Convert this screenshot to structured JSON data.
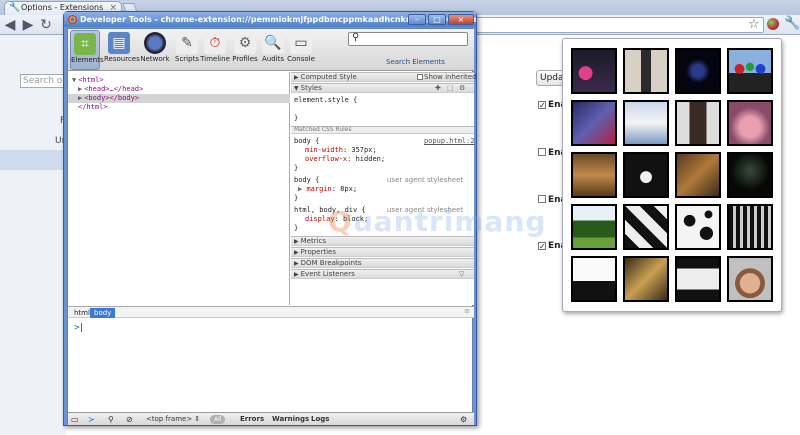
{
  "browser": {
    "tab_title": "Options - Extensions",
    "search_options_placeholder": "Search opti",
    "update_button": "Updat",
    "enable_label": "Ena",
    "nav_labels": [
      "F",
      "Un"
    ]
  },
  "devtools": {
    "window_title": "Developer Tools - chrome-extension://pemmiokmjfppdbmcppmkaadhcnknkkc/popup.html",
    "window_buttons": [
      "minimize",
      "maximize",
      "close"
    ],
    "tools": [
      "Elements",
      "Resources",
      "Network",
      "Scripts",
      "Timeline",
      "Profiles",
      "Audits",
      "Console"
    ],
    "search_label": "Search Elements",
    "dom": [
      "<html>",
      "<head>…</head>",
      "<body></body>",
      "</html>"
    ],
    "sidebar": {
      "computed_style": "Computed Style",
      "show_inherited": "Show inherited",
      "styles": "Styles",
      "element_style": "element.style {",
      "close_brace": "}",
      "matched_rules": "Matched CSS Rules",
      "rule1_selector": "body {",
      "rule1_source": "popup.html:2",
      "rule1_prop1": "min-width",
      "rule1_val1": "357px;",
      "rule1_prop2": "overflow-x",
      "rule1_val2": "hidden;",
      "rule2_selector": "body {",
      "rule2_source": "user agent stylesheet",
      "rule2_prop": "margin",
      "rule2_val": "8px;",
      "rule3_selector": "html, body, div {",
      "rule3_source": "user agent stylesheet",
      "rule3_prop": "display",
      "rule3_val": "block;",
      "metrics": "Metrics",
      "properties": "Properties",
      "dom_breakpoints": "DOM Breakpoints",
      "event_listeners": "Event Listeners"
    },
    "console_tabs": [
      "html",
      "body"
    ],
    "prompt": ">",
    "status": {
      "frame": "<top frame>",
      "all": "All",
      "errors": "Errors",
      "warnings": "Warnings",
      "logs": "Logs"
    }
  },
  "watermark": "uantrimang",
  "colors": {
    "devtools_frame": "#6b92d4",
    "selected_tab": "#3879d9",
    "css_property": "#c80000",
    "tag": "#881280"
  },
  "popup_thumbnails": [
    "pink-monster-photo",
    "person-standing-photo",
    "light-swirl-photo",
    "colored-balls-photo",
    "sneakers-photo",
    "wedding-photo",
    "woman-portrait-photo",
    "hand-photo",
    "railroad-photo",
    "cat-photo",
    "cards-photo",
    "dark-room-photo",
    "tree-photo",
    "puzzle-pattern-photo",
    "cow-pattern-photo",
    "hello-world-photo-1",
    "silhouette-sky-photo",
    "hello-world-photo-2",
    "hello-world-photo-3",
    "man-beanie-photo"
  ]
}
